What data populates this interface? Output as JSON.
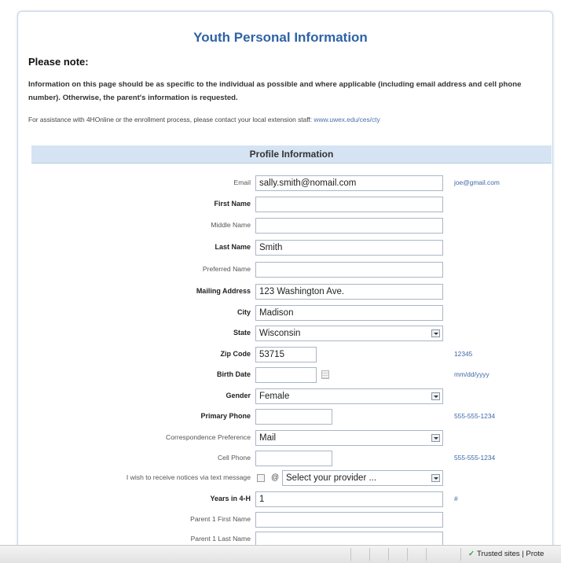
{
  "title": "Youth Personal Information",
  "note": {
    "heading": "Please note:",
    "text": "Information on this page should be as specific to the individual as possible and where applicable (including email address and cell phone number). Otherwise, the parent's information is requested.",
    "assist_text": "For assistance with 4HOnline or the enrollment process, please contact your local extension staff:",
    "assist_link": "www.uwex.edu/ces/cty"
  },
  "section": {
    "title": "Profile Information"
  },
  "form": {
    "email": {
      "label": "Email",
      "value": "sally.smith@nomail.com",
      "hint": "joe@gmail.com"
    },
    "first_name": {
      "label": "First Name",
      "value": ""
    },
    "middle_name": {
      "label": "Middle Name",
      "value": ""
    },
    "last_name": {
      "label": "Last Name",
      "value": "Smith"
    },
    "preferred_name": {
      "label": "Preferred Name",
      "value": ""
    },
    "mailing_address": {
      "label": "Mailing Address",
      "value": "123 Washington Ave."
    },
    "city": {
      "label": "City",
      "value": "Madison"
    },
    "state": {
      "label": "State",
      "value": "Wisconsin"
    },
    "zip": {
      "label": "Zip Code",
      "value": "53715",
      "hint": "12345"
    },
    "birth_date": {
      "label": "Birth Date",
      "value": "",
      "hint": "mm/dd/yyyy"
    },
    "gender": {
      "label": "Gender",
      "value": "Female"
    },
    "primary_phone": {
      "label": "Primary Phone",
      "value": "",
      "hint": "555-555-1234"
    },
    "correspondence": {
      "label": "Correspondence Preference",
      "value": "Mail"
    },
    "cell_phone": {
      "label": "Cell Phone",
      "value": "",
      "hint": "555-555-1234"
    },
    "text_notice": {
      "label": "I wish to receive notices via text message",
      "at": "@",
      "provider": "Select your provider ..."
    },
    "years_4h": {
      "label": "Years in 4-H",
      "value": "1",
      "hint": "#"
    },
    "parent1_first": {
      "label": "Parent 1 First Name",
      "value": ""
    },
    "parent1_last": {
      "label": "Parent 1 Last Name",
      "value": ""
    }
  },
  "statusbar": {
    "zone": "Trusted sites | Prote"
  }
}
